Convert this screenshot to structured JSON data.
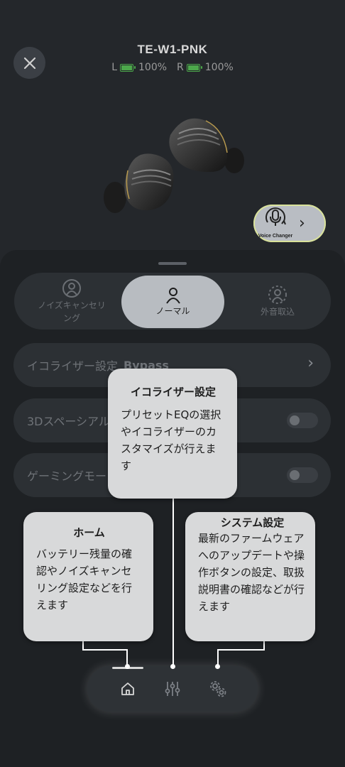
{
  "header": {
    "device_name": "TE-W1-PNK",
    "left_label": "L",
    "left_battery": "100%",
    "right_label": "R",
    "right_battery": "100%",
    "battery_color": "#4ca84b"
  },
  "voice_changer": {
    "label": "Voice Changer",
    "icon": "voice-changer-icon"
  },
  "modes": {
    "items": [
      {
        "label": "ノイズキャンセリ\nング",
        "icon": "noise-cancel-icon",
        "active": false
      },
      {
        "label": "ノーマル",
        "icon": "normal-mode-icon",
        "active": true
      },
      {
        "label": "外音取込",
        "icon": "ambient-icon",
        "active": false
      }
    ]
  },
  "settings": {
    "equalizer_label": "イコライザー設定",
    "equalizer_value": "Bypass",
    "spatial_label": "3Dスペーシアルオーディオ",
    "gaming_label": "ゲーミングモード"
  },
  "tooltips": {
    "equalizer": {
      "title": "イコライザー設定",
      "body": "プリセットEQの選択やイコライザーのカスタマイズが行えます"
    },
    "home": {
      "title": "ホーム",
      "body": "バッテリー残量の確認やノイズキャンセリング設定などを行えます"
    },
    "system": {
      "title": "システム設定",
      "body": "最新のファームウェアへのアップデートや操作ボタンの設定、取扱説明書の確認などが行えます"
    }
  },
  "nav": {
    "items": [
      "home-icon",
      "equalizer-sliders-icon",
      "settings-gears-icon"
    ],
    "active": "home-icon"
  }
}
